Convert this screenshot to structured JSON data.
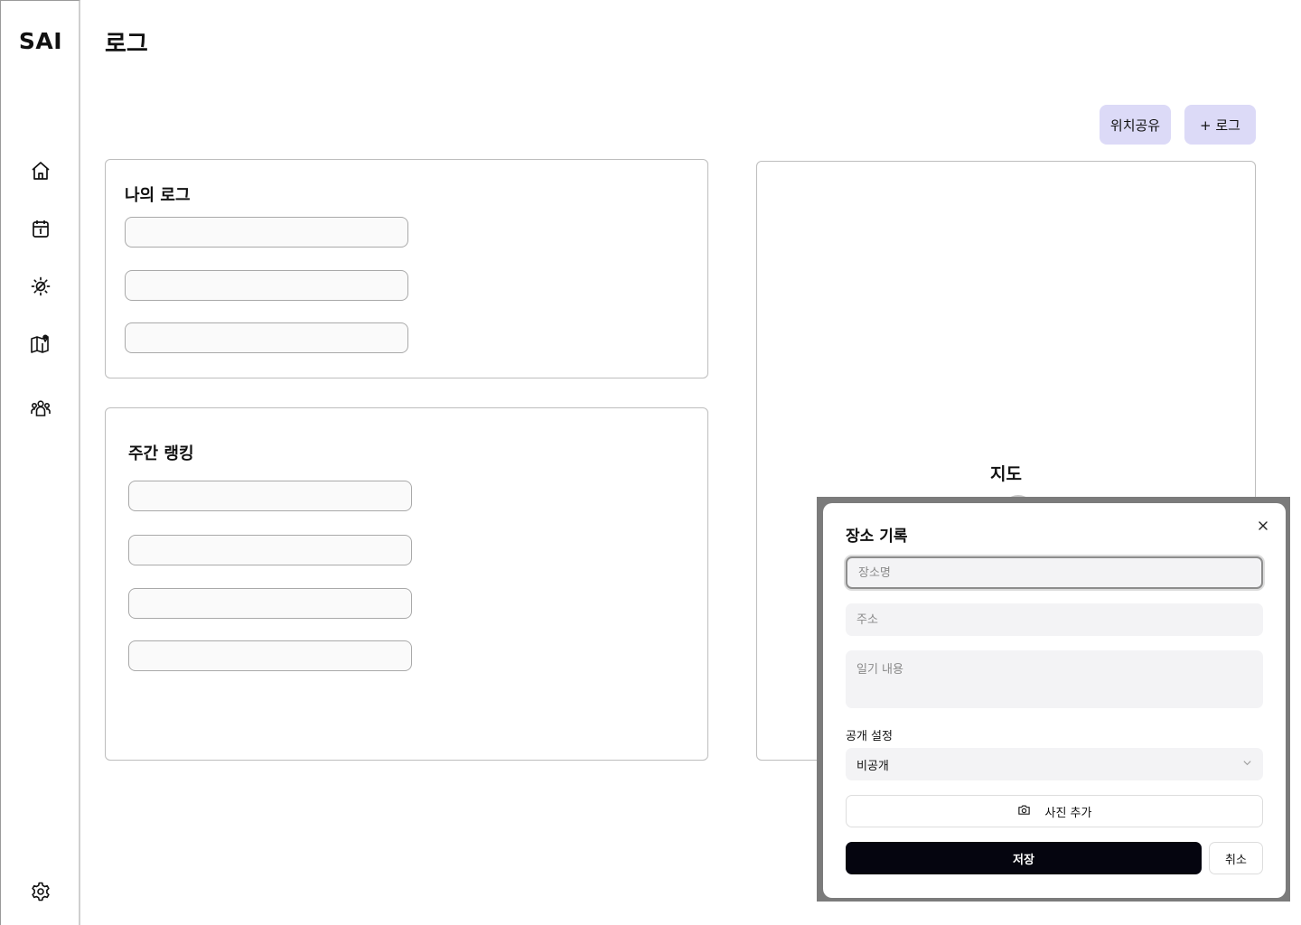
{
  "app": {
    "logo": "SAI"
  },
  "page": {
    "title": "로그"
  },
  "sidebar": {
    "icons": [
      "home-icon",
      "calendar-icon",
      "weather-icon",
      "map-icon",
      "community-icon",
      "settings-icon"
    ]
  },
  "toolbar": {
    "share_location_label": "위치공유",
    "add_log_label": "+ 로그"
  },
  "my_log": {
    "title": "나의 로그",
    "item_count": 3
  },
  "weekly_ranking": {
    "title": "주간 랭킹",
    "item_count": 4
  },
  "map": {
    "title": "지도"
  },
  "modal": {
    "title": "장소 기록",
    "place_name_placeholder": "장소명",
    "address_placeholder": "주소",
    "diary_placeholder": "일기 내용",
    "visibility_label": "공개 설정",
    "visibility_value": "비공개",
    "add_photo_label": "사진 추가",
    "save_label": "저장",
    "cancel_label": "취소"
  },
  "colors": {
    "accent_button": "#dcdaf7",
    "primary_button": "#05050f",
    "field_background": "#f3f3f5"
  }
}
